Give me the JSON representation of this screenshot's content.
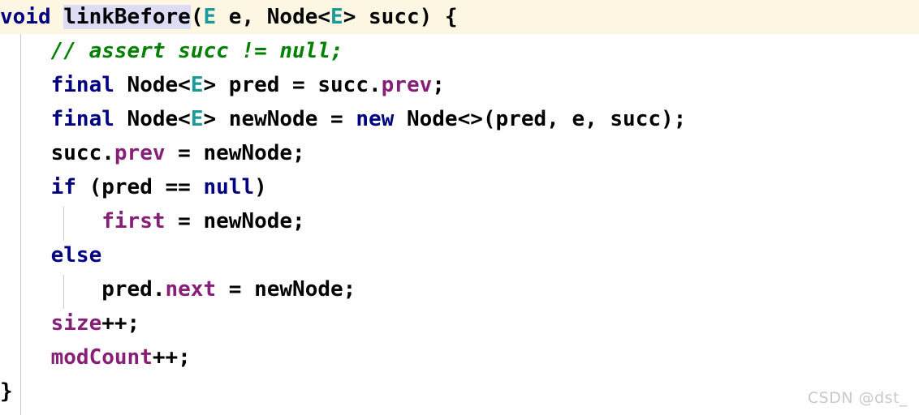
{
  "editor": {
    "language": "java",
    "background_color": "#ffffff",
    "current_line_background": "#fdf6e3",
    "caret_word_highlight_color": "#dcdcf5",
    "indent_guide_color": "#c8c8c8",
    "colors": {
      "keyword": "#000080",
      "plain": "#000000",
      "type_parameter": "#1a9a9a",
      "field": "#871f78",
      "comment": "#008000",
      "watermark": "#c9c9c9"
    }
  },
  "code": {
    "lines": [
      {
        "id": "line-1",
        "text": "void linkBefore(E e, Node<E> succ) {",
        "current_line": true,
        "tokens": [
          {
            "text": "void",
            "kind": "keyword"
          },
          {
            "text": " ",
            "kind": "plain"
          },
          {
            "text": "linkBefore",
            "kind": "method",
            "highlighted": true
          },
          {
            "text": "(",
            "kind": "punct"
          },
          {
            "text": "E",
            "kind": "typeparam"
          },
          {
            "text": " e, ",
            "kind": "plain"
          },
          {
            "text": "Node<",
            "kind": "plain"
          },
          {
            "text": "E",
            "kind": "typeparam"
          },
          {
            "text": "> succ) {",
            "kind": "plain"
          }
        ]
      },
      {
        "id": "line-2",
        "text": "    // assert succ != null;",
        "current_line": false,
        "tokens": [
          {
            "text": "    ",
            "kind": "plain"
          },
          {
            "text": "// assert succ != null;",
            "kind": "comment"
          }
        ]
      },
      {
        "id": "line-3",
        "text": "    final Node<E> pred = succ.prev;",
        "current_line": false,
        "tokens": [
          {
            "text": "    ",
            "kind": "plain"
          },
          {
            "text": "final",
            "kind": "keyword"
          },
          {
            "text": " Node<",
            "kind": "plain"
          },
          {
            "text": "E",
            "kind": "typeparam"
          },
          {
            "text": "> pred = succ.",
            "kind": "plain"
          },
          {
            "text": "prev",
            "kind": "field"
          },
          {
            "text": ";",
            "kind": "plain"
          }
        ]
      },
      {
        "id": "line-4",
        "text": "    final Node<E> newNode = new Node<>(pred, e, succ);",
        "current_line": false,
        "tokens": [
          {
            "text": "    ",
            "kind": "plain"
          },
          {
            "text": "final",
            "kind": "keyword"
          },
          {
            "text": " Node<",
            "kind": "plain"
          },
          {
            "text": "E",
            "kind": "typeparam"
          },
          {
            "text": "> newNode = ",
            "kind": "plain"
          },
          {
            "text": "new",
            "kind": "keyword"
          },
          {
            "text": " Node<>(pred, e, succ);",
            "kind": "plain"
          }
        ]
      },
      {
        "id": "line-5",
        "text": "    succ.prev = newNode;",
        "current_line": false,
        "tokens": [
          {
            "text": "    succ.",
            "kind": "plain"
          },
          {
            "text": "prev",
            "kind": "field"
          },
          {
            "text": " = newNode;",
            "kind": "plain"
          }
        ]
      },
      {
        "id": "line-6",
        "text": "    if (pred == null)",
        "current_line": false,
        "tokens": [
          {
            "text": "    ",
            "kind": "plain"
          },
          {
            "text": "if",
            "kind": "keyword"
          },
          {
            "text": " (pred == ",
            "kind": "plain"
          },
          {
            "text": "null",
            "kind": "keyword"
          },
          {
            "text": ")",
            "kind": "plain"
          }
        ]
      },
      {
        "id": "line-7",
        "text": "        first = newNode;",
        "current_line": false,
        "tokens": [
          {
            "text": "        ",
            "kind": "plain"
          },
          {
            "text": "first",
            "kind": "field"
          },
          {
            "text": " = newNode;",
            "kind": "plain"
          }
        ]
      },
      {
        "id": "line-8",
        "text": "    else",
        "current_line": false,
        "tokens": [
          {
            "text": "    ",
            "kind": "plain"
          },
          {
            "text": "else",
            "kind": "keyword"
          }
        ]
      },
      {
        "id": "line-9",
        "text": "        pred.next = newNode;",
        "current_line": false,
        "tokens": [
          {
            "text": "        pred.",
            "kind": "plain"
          },
          {
            "text": "next",
            "kind": "field"
          },
          {
            "text": " = newNode;",
            "kind": "plain"
          }
        ]
      },
      {
        "id": "line-10",
        "text": "    size++;",
        "current_line": false,
        "tokens": [
          {
            "text": "    ",
            "kind": "plain"
          },
          {
            "text": "size",
            "kind": "field"
          },
          {
            "text": "++;",
            "kind": "plain"
          }
        ]
      },
      {
        "id": "line-11",
        "text": "    modCount++;",
        "current_line": false,
        "tokens": [
          {
            "text": "    ",
            "kind": "plain"
          },
          {
            "text": "modCount",
            "kind": "field"
          },
          {
            "text": "++;",
            "kind": "plain"
          }
        ]
      },
      {
        "id": "line-12",
        "text": "}",
        "current_line": false,
        "tokens": [
          {
            "text": "}",
            "kind": "plain"
          }
        ]
      }
    ]
  },
  "watermark": {
    "text": "CSDN @dst_"
  }
}
